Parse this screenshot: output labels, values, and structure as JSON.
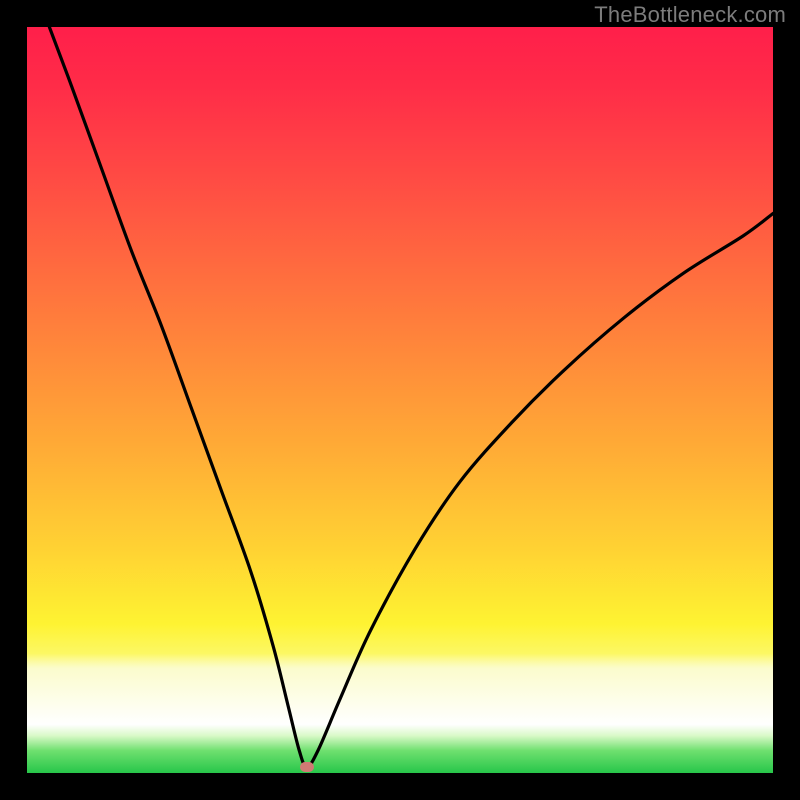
{
  "watermark": "TheBottleneck.com",
  "colors": {
    "frame": "#000000",
    "watermark": "#7c7c7c",
    "curve": "#000000",
    "marker": "#cf7a74"
  },
  "chart_data": {
    "type": "line",
    "title": "",
    "xlabel": "",
    "ylabel": "",
    "xlim": [
      0,
      100
    ],
    "ylim": [
      0,
      100
    ],
    "grid": false,
    "legend": false,
    "description": "Bottleneck-style V curve: steep descent from top-left to a minimum near x≈37 then a shallower rise toward the right. Background is a vertical rainbow gradient (red→orange→yellow→pale→green).",
    "series": [
      {
        "name": "bottleneck-curve",
        "x": [
          3,
          6,
          10,
          14,
          18,
          22,
          26,
          30,
          33,
          35,
          36.5,
          37.5,
          39,
          42,
          46,
          52,
          58,
          65,
          72,
          80,
          88,
          96,
          100
        ],
        "y": [
          100,
          92,
          81,
          70,
          60,
          49,
          38,
          27,
          17,
          9,
          3,
          0.8,
          3,
          10,
          19,
          30,
          39,
          47,
          54,
          61,
          67,
          72,
          75
        ]
      }
    ],
    "marker": {
      "x": 37.5,
      "y": 0.8
    },
    "gradient_stops": [
      {
        "pct": 0,
        "color": "#ff1f4a"
      },
      {
        "pct": 44,
        "color": "#ff8a3a"
      },
      {
        "pct": 80,
        "color": "#fef332"
      },
      {
        "pct": 94,
        "color": "#ffffff"
      },
      {
        "pct": 100,
        "color": "#27c64a"
      }
    ]
  }
}
